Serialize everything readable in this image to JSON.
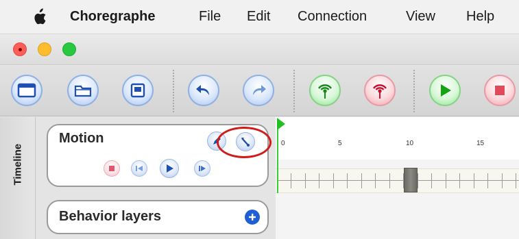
{
  "menubar": {
    "app_name": "Choregraphe",
    "items": [
      "File",
      "Edit",
      "Connection",
      "View",
      "Help"
    ]
  },
  "window": {
    "traffic_lights": [
      "close",
      "minimize",
      "zoom"
    ]
  },
  "toolbar": {
    "buttons": [
      {
        "name": "new-project-button",
        "icon": "window-icon",
        "style": "blue"
      },
      {
        "name": "open-project-button",
        "icon": "folder-icon",
        "style": "blue"
      },
      {
        "name": "save-project-button",
        "icon": "floppy-icon",
        "style": "blue"
      },
      {
        "name": "undo-button",
        "icon": "undo-icon",
        "style": "blue"
      },
      {
        "name": "redo-button",
        "icon": "redo-icon",
        "style": "blue"
      },
      {
        "name": "connect-button",
        "icon": "antenna-icon",
        "style": "green"
      },
      {
        "name": "disconnect-button",
        "icon": "antenna-icon",
        "style": "pink"
      },
      {
        "name": "play-button",
        "icon": "play-icon",
        "style": "green"
      },
      {
        "name": "stop-button",
        "icon": "stop-icon",
        "style": "pink"
      }
    ]
  },
  "sidebar": {
    "tab_label": "Timeline"
  },
  "motion_panel": {
    "title": "Motion"
  },
  "behavior_panel": {
    "title": "Behavior layers"
  },
  "timeline": {
    "frame_labels": [
      "0",
      "5",
      "10",
      "15"
    ]
  },
  "colors": {
    "annotation": "#d21a1a",
    "cursor": "#22c022",
    "accent_blue": "#1f5fd6"
  }
}
